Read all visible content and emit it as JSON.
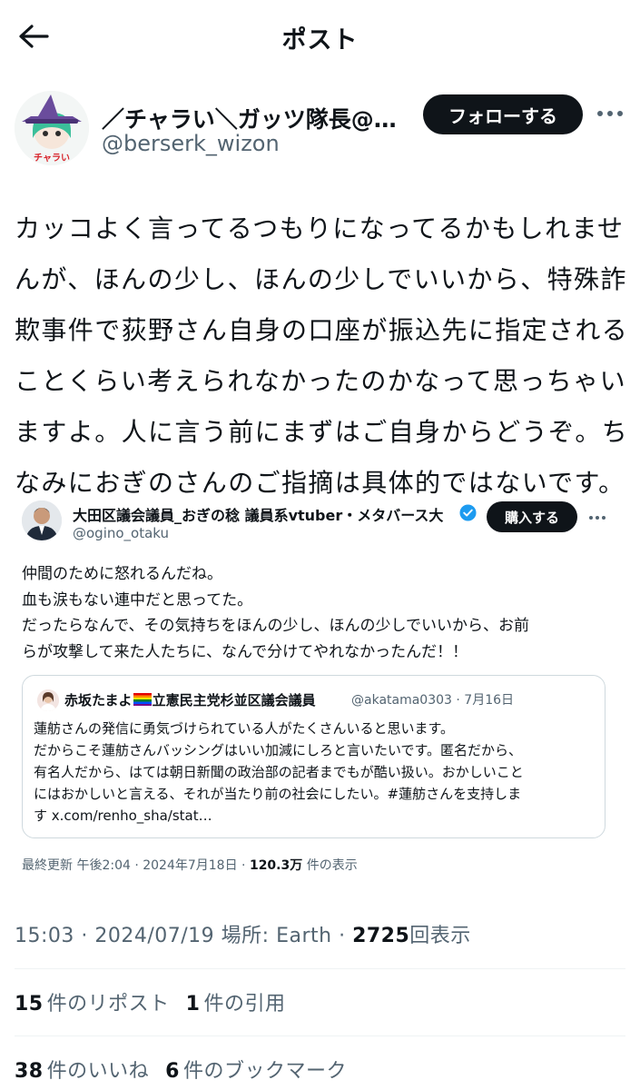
{
  "header": {
    "title": "ポスト",
    "back_icon": "arrow-left-icon"
  },
  "author": {
    "display_name": "／チャラい＼ガッツ隊長@…",
    "handle": "@berserk_wizon",
    "avatar_caption": "チャラい",
    "follow_label": "フォローする",
    "more_icon": "more-horizontal-icon"
  },
  "post": {
    "lines": [
      "カッコよく言ってるつもりになってるかもしれませ",
      "んが、ほんの少し、ほんの少しでいいから、特殊詐",
      "欺事件で荻野さん自身の口座が振込先に指定される",
      "ことくらい考えられなかったのかなって思っちゃい",
      "ますよ。人に言う前にまずはご自身からどうぞ。ち",
      "なみにおぎのさんのご指摘は具体的ではないです。"
    ]
  },
  "embedded": {
    "name": "大田区議会議員_おぎの稔 議員系vtuber・メタバース大",
    "handle": "@ogino_otaku",
    "button_label": "購入する",
    "lines": [
      "仲間のために怒れるんだね。",
      "血も涙もない連中だと思ってた。",
      "だったらなんで、その気持ちをほんの少し、ほんの少しでいいから、お前",
      "らが攻撃して来た人たちに、なんで分けてやれなかったんだ！！"
    ],
    "quote": {
      "name_before": "赤坂たまよ",
      "name_after": "立憲民主党杉並区議会議員",
      "meta": "@akatama0303 · 7月16日",
      "lines": [
        "蓮舫さんの発信に勇気づけられている人がたくさんいると思います。",
        "だからこそ蓮舫さんバッシングはいい加減にしろと言いたいです。匿名だから、",
        "有名人だから、はては朝日新聞の政治部の記者までもが酷い扱い。おかしいこと",
        "にはおかしいと言える、それが当たり前の社会にしたい。#蓮舫さんを支持しま",
        "す x.com/renho_sha/stat…"
      ]
    },
    "updated_prefix": "最終更新 午後2:04 · 2024年7月18日 · ",
    "updated_views": "120.3万",
    "updated_suffix": " 件の表示"
  },
  "meta": {
    "prefix": "15:03 · 2024/07/19 場所: Earth · ",
    "views": "2725",
    "views_label": "回表示"
  },
  "stats": {
    "reposts": "15",
    "reposts_label": "件のリポスト",
    "quotes": "1",
    "quotes_label": "件の引用",
    "likes": "38",
    "likes_label": "件のいいね",
    "bookmarks": "6",
    "bookmarks_label": "件のブックマーク"
  }
}
